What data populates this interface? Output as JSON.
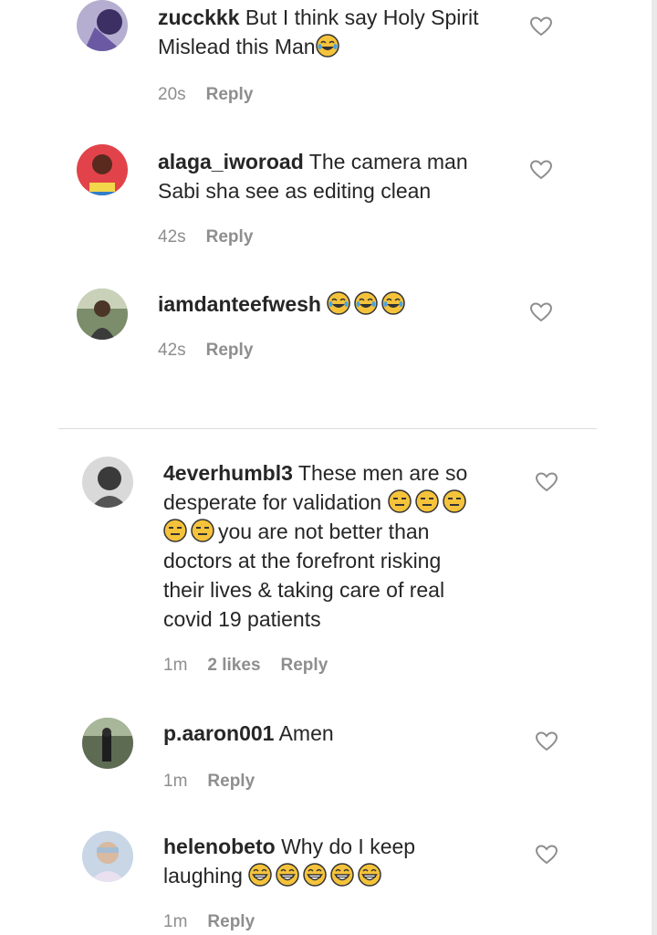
{
  "comments": [
    {
      "username": "zucckkk",
      "lines": [
        "But I think say Holy Spirit",
        "Mislead this Man"
      ],
      "emoji": "😂",
      "time": "20s",
      "likes": "",
      "reply": "Reply"
    },
    {
      "username": "alaga_iworoad",
      "lines": [
        "The camera man",
        "Sabi sha see as editing clean"
      ],
      "time": "42s",
      "likes": "",
      "reply": "Reply"
    },
    {
      "username": "iamdanteefwesh",
      "lines": [
        ""
      ],
      "emoji": "😂😂😂",
      "time": "42s",
      "likes": "",
      "reply": "Reply"
    },
    {
      "username": "4everhumbl3",
      "lines": [
        "These men are so",
        "desperate for validation",
        "you are not better than",
        "doctors at the forefront risking",
        "their lives & taking care of real",
        "covid 19 patients"
      ],
      "emoji": "😑😑😑😑😑",
      "time": "1m",
      "likes": "2 likes",
      "reply": "Reply"
    },
    {
      "username": "p.aaron001",
      "lines": [
        "Amen"
      ],
      "time": "1m",
      "likes": "",
      "reply": "Reply"
    },
    {
      "username": "helenobeto",
      "lines": [
        "Why do I keep",
        "laughing"
      ],
      "emoji": "😁😁😁😁😁",
      "time": "1m",
      "likes": "",
      "reply": "Reply"
    }
  ],
  "colors": {
    "text": "#262626",
    "meta": "#8e8e8e",
    "divider": "#dbdbdb",
    "emoji_face": "#f5c33b"
  },
  "icons": {
    "like": "heart-outline-icon"
  }
}
